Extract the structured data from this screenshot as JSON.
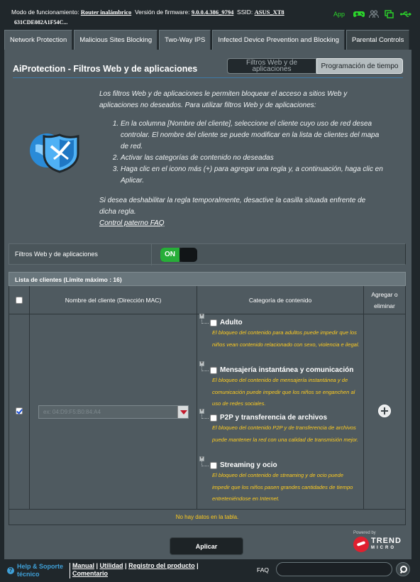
{
  "topbar": {
    "mode_label": "Modo de funcionamiento:",
    "mode_value": "Router inalámbrico",
    "firmware_label": "Versión de firmware:",
    "firmware_value": "9.0.0.4.386_9794",
    "ssid_label": "SSID:",
    "ssid_value": "ASUS_XT8",
    "ssid_line2": "631CDE082A1F54C...",
    "app_label": "App",
    "icons": [
      "gamepad-icon",
      "users-icon",
      "copy-icon",
      "usb-icon"
    ],
    "accent_color": "#2bd62b"
  },
  "tabs": [
    {
      "label": "Network Protection",
      "active": false
    },
    {
      "label": "Malicious Sites Blocking",
      "active": false
    },
    {
      "label": "Two-Way IPS",
      "active": false
    },
    {
      "label": "Infected Device Prevention and Blocking",
      "active": false
    },
    {
      "label": "Parental Controls",
      "active": true
    }
  ],
  "page": {
    "title": "AiProtection - Filtros Web y de aplicaciones",
    "switch_active": "Filtros Web y de aplicaciones",
    "switch_other": "Programación de tiempo"
  },
  "description": {
    "intro": "Los filtros Web y de aplicaciones le permiten bloquear el acceso a sitios Web y aplicaciones no deseados. Para utilizar filtros Web y de aplicaciones:",
    "steps": [
      "En la columna [Nombre del cliente], seleccione el cliente cuyo uso de red desea controlar. El nombre del cliente se puede modificar en la lista de clientes del mapa de red.",
      "Activar las categorías de contenido no deseadas",
      "Haga clic en el icono más (+) para agregar una regla y, a continuación, haga clic en Aplicar."
    ],
    "note": "Si desea deshabilitar la regla temporalmente, desactive la casilla situada enfrente de dicha regla.",
    "faq_link": "Control paterno FAQ"
  },
  "toggle_row": {
    "label": "Filtros Web y de aplicaciones",
    "state": "ON",
    "on_color": "#27ae38"
  },
  "client_table": {
    "caption": "Lista de clientes (Límite máximo : 16)",
    "headers": {
      "name": "Nombre del cliente (Dirección MAC)",
      "category": "Categoría de contenido",
      "add_remove": "Agregar o eliminar"
    },
    "row_checked": true,
    "client_select_value": "ex: 04:D9:F5:B0:84:A4",
    "categories": [
      {
        "title": "Adulto",
        "desc": "El bloqueo del contenido para adultos puede impedir que los niños vean contenido relacionado con sexo, violencia e ilegal."
      },
      {
        "title": "Mensajería instantánea y comunicación",
        "desc": "El bloqueo del contenido de mensajería instantánea y de comunicación puede impedir que los niños se enganchen al uso de redes sociales."
      },
      {
        "title": "P2P y transferencia de archivos",
        "desc": "El bloqueo del contenido P2P y de transferencia de archivos puede mantener la red con una calidad de transmisión mejor."
      },
      {
        "title": "Streaming y ocio",
        "desc": "El bloqueo del contenido de streaming y de ocio puede impedir que los niños pasen grandes cantidades de tiempo entreteniéndose en Internet."
      }
    ],
    "empty_text": "No hay datos en la tabla.",
    "desc_color": "#ffcc1f"
  },
  "apply_label": "Aplicar",
  "powered_by": {
    "text": "Powered by",
    "brand_line1": "TREND",
    "brand_line2": "MICRO",
    "brand_color": "#e0202f"
  },
  "footer": {
    "help_line1": "Help & Soporte",
    "help_line2": "técnico",
    "link_manual": "Manual",
    "link_utility": "Utilidad",
    "link_register": "Registro del producto",
    "link_comments": "Comentario",
    "faq_label": "FAQ",
    "search_placeholder": ""
  }
}
